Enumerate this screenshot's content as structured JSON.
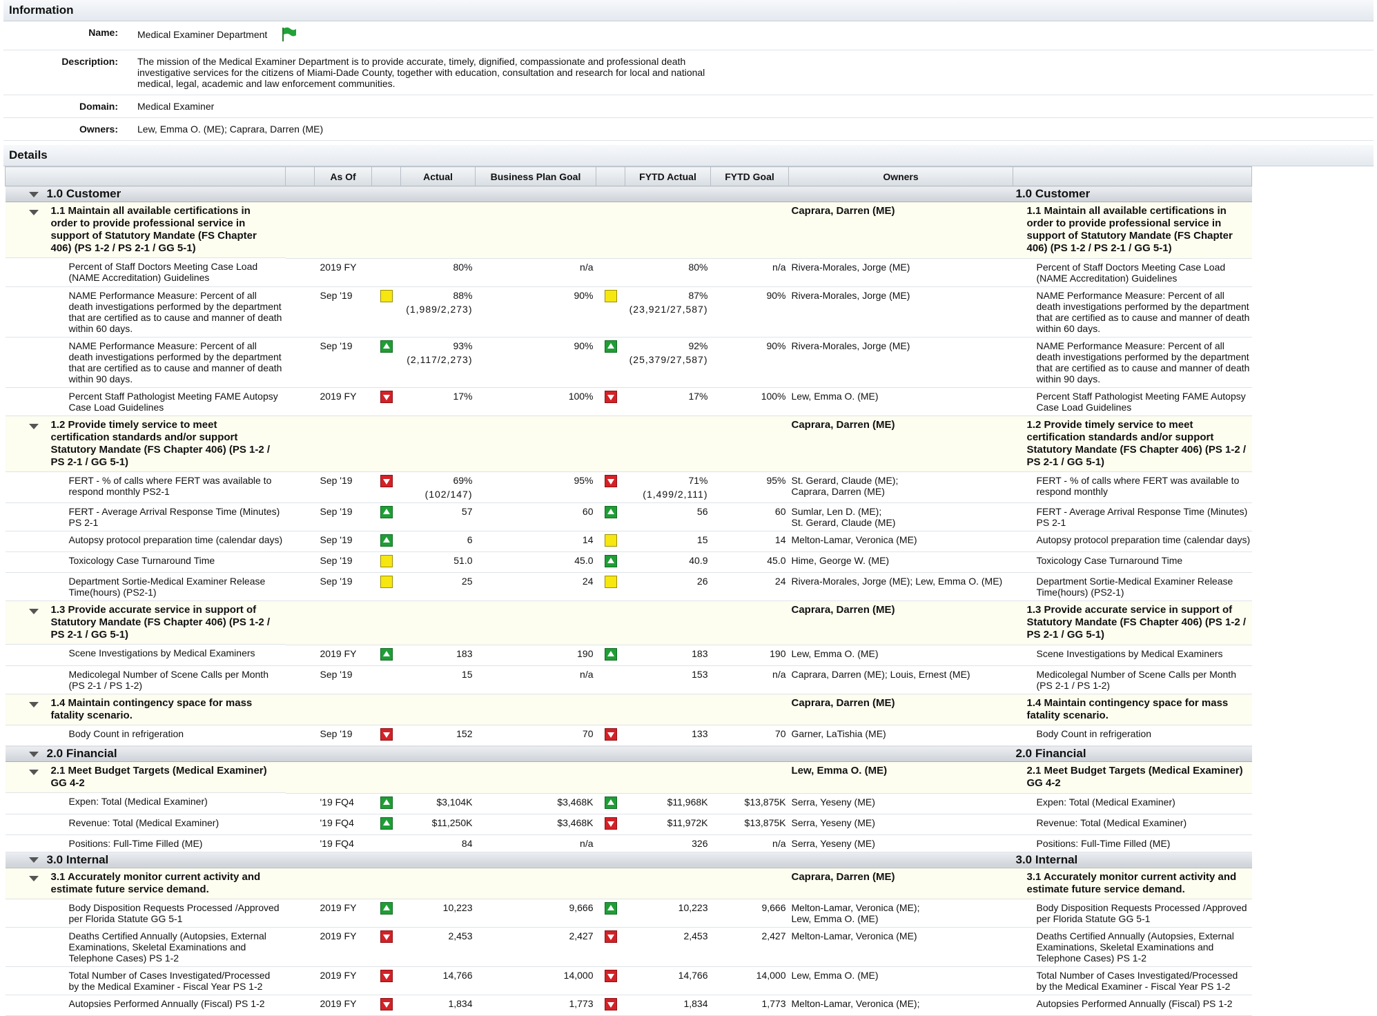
{
  "info": {
    "header": "Information",
    "name_label": "Name:",
    "name": "Medical Examiner Department",
    "description_label": "Description:",
    "description": "The mission of the Medical Examiner Department is to provide accurate, timely, dignified, compassionate and professional death investigative services for the citizens of Miami-Dade County, together with education, consultation and research for local and national medical, legal, academic and law enforcement communities.",
    "domain_label": "Domain:",
    "domain": "Medical Examiner",
    "owners_label": "Owners:",
    "owners": "Lew, Emma O. (ME); Caprara, Darren (ME)"
  },
  "details": {
    "header": "Details",
    "columns": [
      "",
      "As Of",
      "",
      "Actual",
      "Business Plan Goal",
      "",
      "FYTD Actual",
      "FYTD Goal",
      "Owners",
      ""
    ],
    "rows": [
      {
        "type": "persp",
        "name": "1.0 Customer"
      },
      {
        "type": "obj",
        "name": "1.1 Maintain all available certifications in order to provide professional service in support of Statutory Mandate (FS Chapter 406) (PS 1-2 / PS 2-1 / GG 5-1)",
        "owner": "Caprara, Darren (ME)"
      },
      {
        "type": "m",
        "name": "Percent of Staff Doctors Meeting Case Load (NAME Accreditation) Guidelines",
        "asof": "2019 FY",
        "ind1": "",
        "actual": "80%",
        "actual_sub": "",
        "goal": "n/a",
        "ind2": "",
        "fytd": "80%",
        "fytd_sub": "",
        "fytdgoal": "n/a",
        "owners": "Rivera-Morales, Jorge (ME)",
        "owners2": "",
        "right": "Percent of Staff Doctors Meeting Case Load (NAME Accreditation) Guidelines"
      },
      {
        "type": "m",
        "name": "NAME Performance Measure: Percent of all death investigations performed by the department that are certified as to cause and manner of death within 60 days.",
        "asof": "Sep '19",
        "ind1": "yellow",
        "actual": "88%",
        "actual_sub": "(1,989/2,273)",
        "goal": "90%",
        "ind2": "yellow",
        "fytd": "87%",
        "fytd_sub": "(23,921/27,587)",
        "fytdgoal": "90%",
        "owners": "Rivera-Morales, Jorge (ME)",
        "owners2": "",
        "right": "NAME Performance Measure: Percent of all death investigations performed by the department that are certified as to cause and manner of death within 60 days."
      },
      {
        "type": "m",
        "name": "NAME Performance Measure: Percent of all death investigations performed by the department that are certified as to cause and manner of death within 90 days.",
        "asof": "Sep '19",
        "ind1": "green",
        "actual": "93%",
        "actual_sub": "(2,117/2,273)",
        "goal": "90%",
        "ind2": "green",
        "fytd": "92%",
        "fytd_sub": "(25,379/27,587)",
        "fytdgoal": "90%",
        "owners": "Rivera-Morales, Jorge (ME)",
        "owners2": "",
        "right": "NAME Performance Measure: Percent of all death investigations performed by the department that are certified as to cause and manner of death within 90 days."
      },
      {
        "type": "m",
        "name": "Percent Staff Pathologist Meeting FAME Autopsy Case Load Guidelines",
        "asof": "2019 FY",
        "ind1": "red",
        "actual": "17%",
        "actual_sub": "",
        "goal": "100%",
        "ind2": "red",
        "fytd": "17%",
        "fytd_sub": "",
        "fytdgoal": "100%",
        "owners": "Lew, Emma O. (ME)",
        "owners2": "",
        "right": "Percent Staff Pathologist Meeting FAME Autopsy Case Load Guidelines"
      },
      {
        "type": "obj",
        "name": "1.2  Provide timely service to meet certification standards and/or support Statutory Mandate (FS Chapter 406) (PS 1-2 / PS 2-1 / GG 5-1)",
        "owner": "Caprara, Darren (ME)"
      },
      {
        "type": "m",
        "name": "FERT - % of calls where FERT was available to respond monthly PS2-1",
        "asof": "Sep '19",
        "ind1": "red",
        "actual": "69%",
        "actual_sub": "(102/147)",
        "goal": "95%",
        "ind2": "red",
        "fytd": "71%",
        "fytd_sub": "(1,499/2,111)",
        "fytdgoal": "95%",
        "owners": "St. Gerard, Claude (ME);",
        "owners2": "Caprara, Darren (ME)",
        "right": "FERT - % of calls where FERT was available to respond monthly"
      },
      {
        "type": "m",
        "name": "FERT - Average Arrival Response Time (Minutes) PS 2-1",
        "asof": "Sep '19",
        "ind1": "green",
        "actual": "57",
        "actual_sub": "",
        "goal": "60",
        "ind2": "green",
        "fytd": "56",
        "fytd_sub": "",
        "fytdgoal": "60",
        "owners": "Sumlar, Len D. (ME);",
        "owners2": "St. Gerard, Claude (ME)",
        "right": "FERT - Average Arrival Response Time (Minutes) PS 2-1"
      },
      {
        "type": "m",
        "name": "Autopsy protocol preparation time (calendar days)",
        "asof": "Sep '19",
        "ind1": "green",
        "actual": "6",
        "actual_sub": "",
        "goal": "14",
        "ind2": "yellow",
        "fytd": "15",
        "fytd_sub": "",
        "fytdgoal": "14",
        "owners": "Melton-Lamar, Veronica (ME)",
        "owners2": "",
        "right": "Autopsy protocol preparation time (calendar days)"
      },
      {
        "type": "m",
        "name": "Toxicology Case Turnaround Time",
        "asof": "Sep '19",
        "ind1": "yellow",
        "actual": "51.0",
        "actual_sub": "",
        "goal": "45.0",
        "ind2": "green",
        "fytd": "40.9",
        "fytd_sub": "",
        "fytdgoal": "45.0",
        "owners": "Hime, George W. (ME)",
        "owners2": "",
        "right": "Toxicology Case Turnaround Time"
      },
      {
        "type": "m",
        "name": "Department Sortie-Medical Examiner Release Time(hours) (PS2-1)",
        "asof": "Sep '19",
        "ind1": "yellow",
        "actual": "25",
        "actual_sub": "",
        "goal": "24",
        "ind2": "yellow",
        "fytd": "26",
        "fytd_sub": "",
        "fytdgoal": "24",
        "owners": "Rivera-Morales, Jorge (ME); Lew, Emma O. (ME)",
        "owners2": "",
        "right": "Department Sortie-Medical Examiner Release Time(hours) (PS2-1)"
      },
      {
        "type": "obj",
        "name": "1.3 Provide accurate service in support of Statutory Mandate (FS Chapter 406) (PS 1-2 / PS 2-1 / GG 5-1)",
        "owner": "Caprara, Darren (ME)"
      },
      {
        "type": "m",
        "name": "Scene Investigations by Medical Examiners",
        "asof": "2019 FY",
        "ind1": "green",
        "actual": "183",
        "actual_sub": "",
        "goal": "190",
        "ind2": "green",
        "fytd": "183",
        "fytd_sub": "",
        "fytdgoal": "190",
        "owners": "Lew, Emma O. (ME)",
        "owners2": "",
        "right": "Scene Investigations by Medical Examiners"
      },
      {
        "type": "m",
        "name": "Medicolegal Number of Scene Calls per Month (PS 2-1 / PS 1-2)",
        "asof": "Sep '19",
        "ind1": "",
        "actual": "15",
        "actual_sub": "",
        "goal": "n/a",
        "ind2": "",
        "fytd": "153",
        "fytd_sub": "",
        "fytdgoal": "n/a",
        "owners": "Caprara, Darren (ME); Louis, Ernest (ME)",
        "owners2": "",
        "right": "Medicolegal Number of Scene Calls per Month (PS 2-1 / PS 1-2)"
      },
      {
        "type": "obj",
        "name": "1.4 Maintain contingency space for mass fatality scenario.",
        "owner": "Caprara, Darren (ME)"
      },
      {
        "type": "m",
        "name": "Body Count in refrigeration",
        "asof": "Sep '19",
        "ind1": "red",
        "actual": "152",
        "actual_sub": "",
        "goal": "70",
        "ind2": "red",
        "fytd": "133",
        "fytd_sub": "",
        "fytdgoal": "70",
        "owners": "Garner, LaTishia (ME)",
        "owners2": "",
        "right": "Body Count in refrigeration"
      },
      {
        "type": "persp",
        "name": "2.0 Financial"
      },
      {
        "type": "obj",
        "name": "2.1 Meet Budget Targets (Medical Examiner) GG 4-2",
        "owner": "Lew, Emma O. (ME)"
      },
      {
        "type": "m",
        "name": "Expen: Total (Medical Examiner)",
        "asof": "'19 FQ4",
        "ind1": "green",
        "actual": "$3,104K",
        "actual_sub": "",
        "goal": "$3,468K",
        "ind2": "green",
        "fytd": "$11,968K",
        "fytd_sub": "",
        "fytdgoal": "$13,875K",
        "owners": "Serra, Yeseny (ME)",
        "owners2": "",
        "right": "Expen: Total (Medical Examiner)"
      },
      {
        "type": "m",
        "name": "Revenue: Total (Medical Examiner)",
        "asof": "'19 FQ4",
        "ind1": "green",
        "actual": "$11,250K",
        "actual_sub": "",
        "goal": "$3,468K",
        "ind2": "red",
        "fytd": "$11,972K",
        "fytd_sub": "",
        "fytdgoal": "$13,875K",
        "owners": "Serra, Yeseny (ME)",
        "owners2": "",
        "right": "Revenue: Total (Medical Examiner)"
      },
      {
        "type": "m",
        "name": "Positions: Full-Time Filled (ME)",
        "asof": "'19 FQ4",
        "ind1": "",
        "actual": "84",
        "actual_sub": "",
        "goal": "n/a",
        "ind2": "",
        "fytd": "326",
        "fytd_sub": "",
        "fytdgoal": "n/a",
        "owners": "Serra, Yeseny (ME)",
        "owners2": "",
        "right": "Positions: Full-Time Filled (ME)"
      },
      {
        "type": "persp",
        "name": "3.0 Internal"
      },
      {
        "type": "obj",
        "name": "3.1 Accurately monitor current activity and estimate future service demand.",
        "owner": "Caprara, Darren (ME)"
      },
      {
        "type": "m",
        "name": "Body Disposition Requests Processed /Approved per Florida Statute GG 5-1",
        "asof": "2019 FY",
        "ind1": "green",
        "actual": "10,223",
        "actual_sub": "",
        "goal": "9,666",
        "ind2": "green",
        "fytd": "10,223",
        "fytd_sub": "",
        "fytdgoal": "9,666",
        "owners": "Melton-Lamar, Veronica (ME);",
        "owners2": "Lew, Emma O. (ME)",
        "right": "Body Disposition Requests Processed /Approved per Florida Statute GG 5-1"
      },
      {
        "type": "m",
        "name": "Deaths Certified Annually (Autopsies, External Examinations, Skeletal Examinations and Telephone Cases) PS 1-2",
        "asof": "2019 FY",
        "ind1": "red",
        "actual": "2,453",
        "actual_sub": "",
        "goal": "2,427",
        "ind2": "red",
        "fytd": "2,453",
        "fytd_sub": "",
        "fytdgoal": "2,427",
        "owners": "Melton-Lamar, Veronica (ME)",
        "owners2": "",
        "right": "Deaths Certified Annually (Autopsies, External Examinations, Skeletal Examinations and Telephone Cases) PS 1-2"
      },
      {
        "type": "m",
        "name": "Total Number of Cases Investigated/Processed by the Medical Examiner - Fiscal Year PS 1-2",
        "asof": "2019 FY",
        "ind1": "red",
        "actual": "14,766",
        "actual_sub": "",
        "goal": "14,000",
        "ind2": "red",
        "fytd": "14,766",
        "fytd_sub": "",
        "fytdgoal": "14,000",
        "owners": "Lew, Emma O. (ME)",
        "owners2": "",
        "right": "Total Number of Cases Investigated/Processed by the Medical Examiner - Fiscal Year PS 1-2"
      },
      {
        "type": "m",
        "name": "Autopsies Performed Annually (Fiscal) PS 1-2",
        "asof": "2019 FY",
        "ind1": "red",
        "actual": "1,834",
        "actual_sub": "",
        "goal": "1,773",
        "ind2": "red",
        "fytd": "1,834",
        "fytd_sub": "",
        "fytdgoal": "1,773",
        "owners": "Melton-Lamar, Veronica (ME);",
        "owners2": "",
        "right": "Autopsies Performed Annually (Fiscal) PS 1-2"
      }
    ]
  }
}
